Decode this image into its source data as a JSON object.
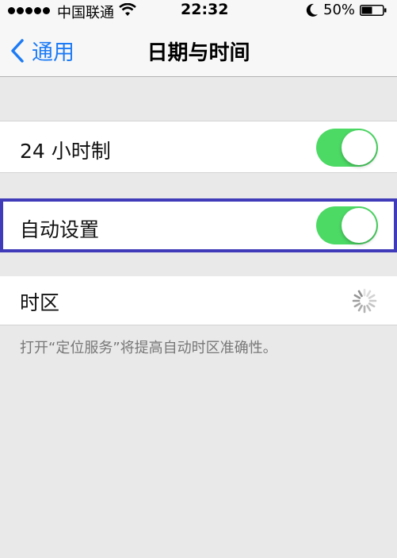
{
  "status_bar": {
    "carrier": "中国联通",
    "time": "22:32",
    "battery_percent": "50%",
    "battery_level": 0.5,
    "signal_bars": 5
  },
  "nav": {
    "back_label": "通用",
    "title": "日期与时间"
  },
  "settings": {
    "hour24": {
      "label": "24 小时制",
      "on": true
    },
    "auto_set": {
      "label": "自动设置",
      "on": true
    },
    "timezone": {
      "label": "时区"
    }
  },
  "footer_note": "打开“定位服务”将提高自动时区准确性。",
  "colors": {
    "accent": "#1d7bf5",
    "toggle_on": "#4cd964",
    "highlight_border": "#3f3bb9"
  },
  "icons": [
    "wifi-icon",
    "moon-icon",
    "battery-icon",
    "chevron-left-icon",
    "loading-spinner-icon"
  ]
}
